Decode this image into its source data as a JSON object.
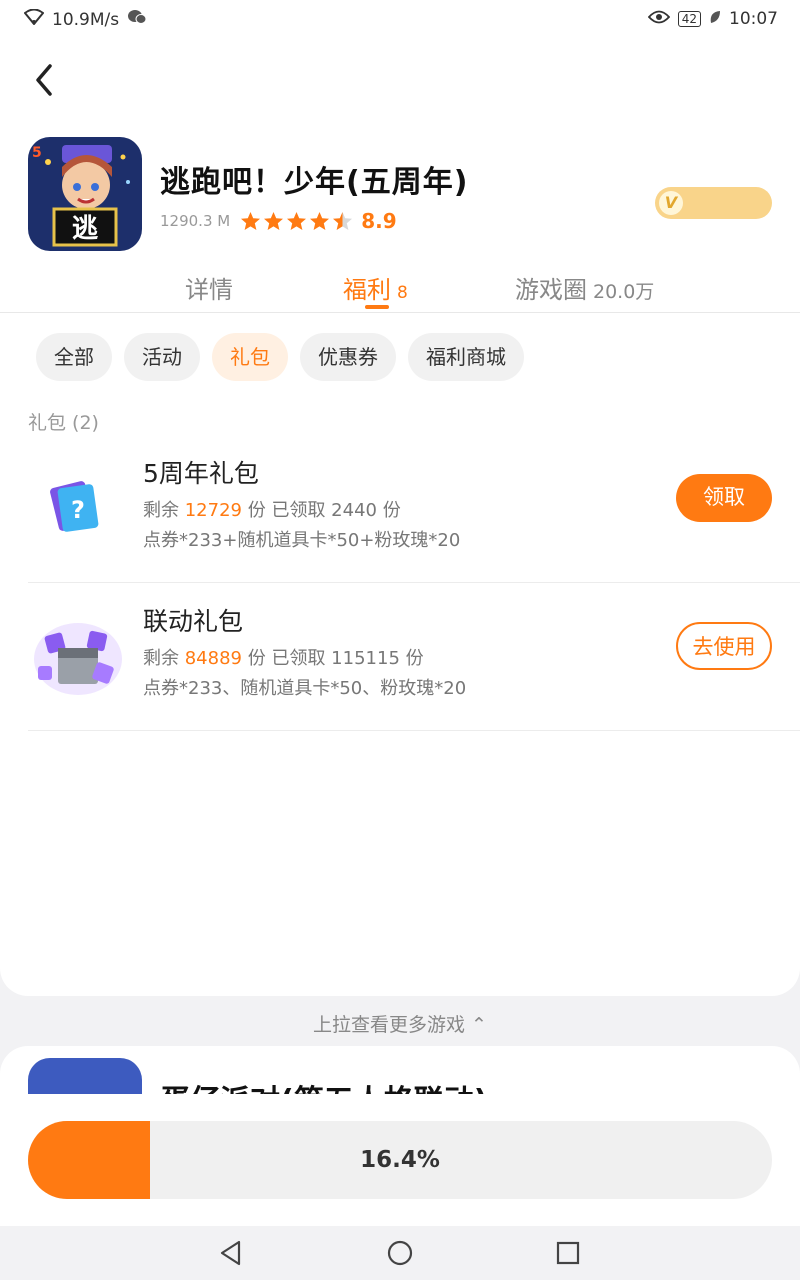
{
  "status": {
    "network_speed": "10.9M/s",
    "battery": "42",
    "time": "10:07"
  },
  "app": {
    "title": "逃跑吧！少年(五周年)",
    "size": "1290.3 M",
    "rating": "8.9",
    "stars": 4.5,
    "vip_mark": "V"
  },
  "tabs": [
    {
      "label": "详情",
      "count": ""
    },
    {
      "label": "福利",
      "count": "8"
    },
    {
      "label": "游戏圈",
      "count": "20.0万"
    }
  ],
  "chips": [
    "全部",
    "活动",
    "礼包",
    "优惠券",
    "福利商城"
  ],
  "section_label": "礼包 (2)",
  "gifts": [
    {
      "name": "5周年礼包",
      "remaining_prefix": "剩余",
      "remaining": "12729",
      "claimed_text": "份 已领取 2440 份",
      "desc": "点券*233+随机道具卡*50+粉玫瑰*20",
      "button": "领取"
    },
    {
      "name": "联动礼包",
      "remaining_prefix": "剩余",
      "remaining": "84889",
      "claimed_text": "份 已领取 115115 份",
      "desc": "点券*233、随机道具卡*50、粉玫瑰*20",
      "button": "去使用"
    }
  ],
  "pull_hint": "上拉查看更多游戏 ⌃",
  "next_game_title": "蛋仔派对(第五人格联动)",
  "progress": {
    "value": 0.164,
    "label": "16.4%"
  },
  "colors": {
    "accent": "#ff7a12",
    "vip": "#f9d48a"
  }
}
